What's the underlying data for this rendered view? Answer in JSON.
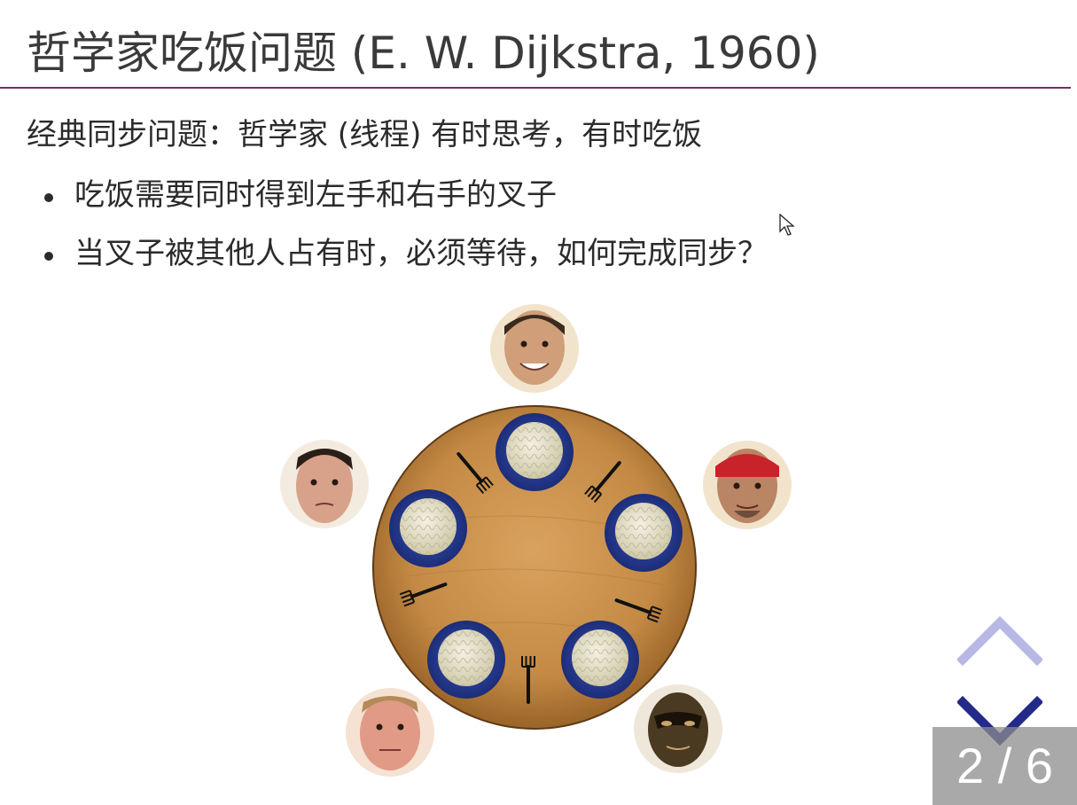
{
  "slide": {
    "title": "哲学家吃饭问题 (E. W. Dijkstra, 1960)",
    "subtitle": "经典同步问题：哲学家 (线程) 有时思考，有时吃饭",
    "bullets": [
      "吃饭需要同时得到左手和右手的叉子",
      "当叉子被其他人占有时，必须等待，如何完成同步？"
    ]
  },
  "pager": {
    "current": "2",
    "separator": "/",
    "total": "6",
    "up_icon": "chevron-up-icon",
    "down_icon": "chevron-down-icon"
  },
  "colors": {
    "title_rule": "#7a2b63",
    "nav_up": "#b8b8e6",
    "nav_down": "#232a8a",
    "table": "#c48a45",
    "plate": "#2a3f9a"
  }
}
